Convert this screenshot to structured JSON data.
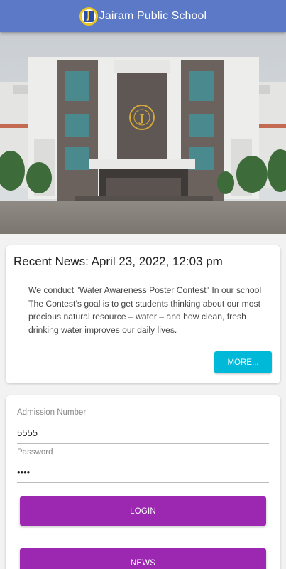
{
  "appbar": {
    "title": "Jairam Public School",
    "logo_letter": "J"
  },
  "banner": {
    "crest_letter": "J"
  },
  "news": {
    "heading": "Recent News: April 23, 2022, 12:03 pm",
    "body": "We conduct \"Water Awareness Poster Contest\" In our school The Contest’s goal is to get students thinking about our most precious natural resource – water – and how clean, fresh drinking water improves our daily lives.",
    "more_label": "MORE..."
  },
  "login": {
    "admission_label": "Admission Number",
    "admission_value": "5555",
    "password_label": "Password",
    "password_value": "••••",
    "login_label": "LOGIN",
    "news_label": "NEWS"
  },
  "colors": {
    "appbar": "#5b79c6",
    "accent_cyan": "#00b9d9",
    "accent_purple": "#9c27b0"
  }
}
